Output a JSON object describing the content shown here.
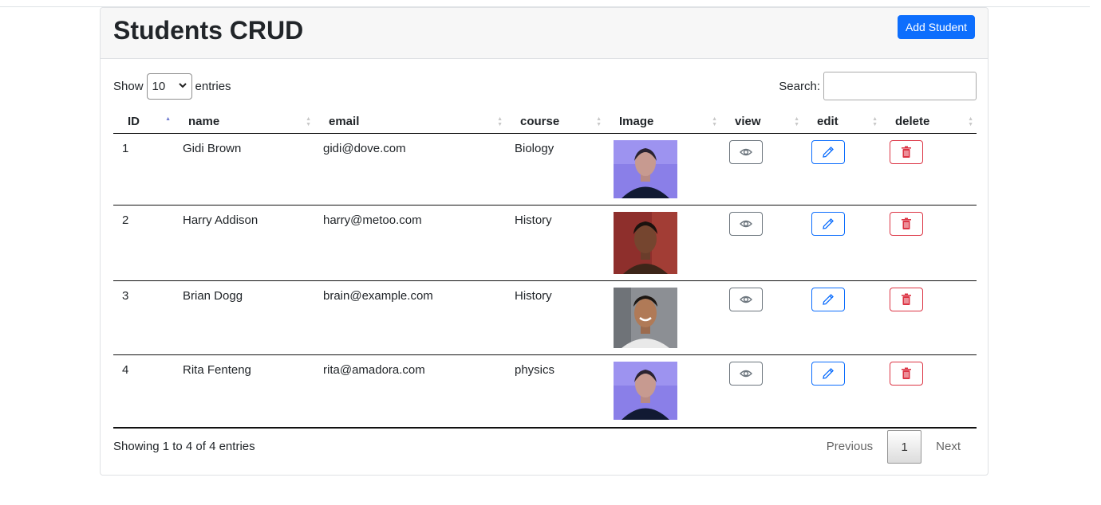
{
  "header": {
    "title": "Students CRUD",
    "add_button": "Add Student"
  },
  "controls": {
    "show_label": "Show",
    "entries_label": "entries",
    "page_length": "10",
    "search_label": "Search:",
    "search_value": ""
  },
  "table": {
    "columns": [
      "ID",
      "name",
      "email",
      "course",
      "Image",
      "view",
      "edit",
      "delete"
    ],
    "sorted_column": "ID",
    "sort_direction": "ascending",
    "rows": [
      {
        "id": "1",
        "name": "Gidi Brown",
        "email": "gidi@dove.com",
        "course": "Biology",
        "image": "portrait-woman-blue-light"
      },
      {
        "id": "2",
        "name": "Harry Addison",
        "email": "harry@metoo.com",
        "course": "History",
        "image": "portrait-woman-red-background"
      },
      {
        "id": "3",
        "name": "Brian Dogg",
        "email": "brain@example.com",
        "course": "History",
        "image": "portrait-man-smiling"
      },
      {
        "id": "4",
        "name": "Rita Fenteng",
        "email": "rita@amadora.com",
        "course": "physics",
        "image": "portrait-woman-blue-light"
      }
    ],
    "row_actions": {
      "view_icon": "eye-icon",
      "edit_icon": "pencil-icon",
      "delete_icon": "trash-icon"
    }
  },
  "footer": {
    "info": "Showing 1 to 4 of 4 entries",
    "previous": "Previous",
    "current_page": "1",
    "next": "Next"
  },
  "colors": {
    "primary": "#0d6efd",
    "secondary": "#6c757d",
    "danger": "#dc3545",
    "header_bg": "#f7f7f7"
  }
}
